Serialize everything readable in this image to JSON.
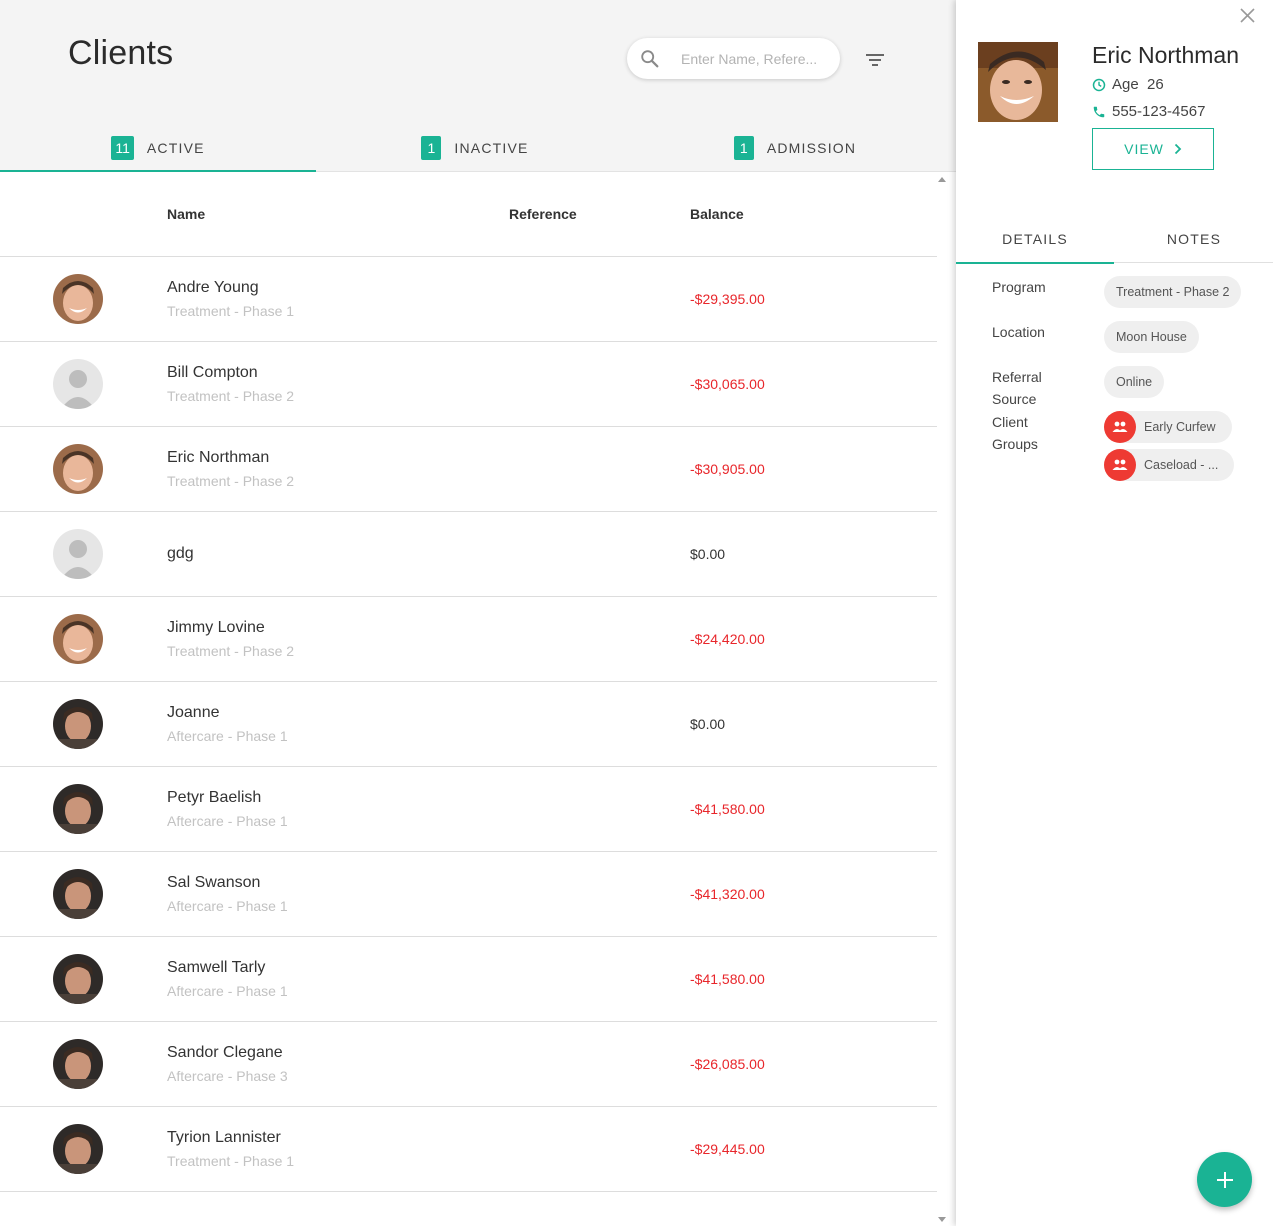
{
  "header": {
    "title": "Clients",
    "search_placeholder": "Enter Name, Refere..."
  },
  "tabs": [
    {
      "count": "11",
      "label": "ACTIVE"
    },
    {
      "count": "1",
      "label": "INACTIVE"
    },
    {
      "count": "1",
      "label": "ADMISSION"
    }
  ],
  "table": {
    "columns": [
      "Name",
      "Reference",
      "Balance"
    ],
    "rows": [
      {
        "name": "Andre Young",
        "program": "Treatment - Phase 1",
        "balance": "-$29,395.00",
        "avatar": "photo-light"
      },
      {
        "name": "Bill Compton",
        "program": "Treatment - Phase 2",
        "balance": "-$30,065.00",
        "avatar": "placeholder"
      },
      {
        "name": "Eric Northman",
        "program": "Treatment - Phase 2",
        "balance": "-$30,905.00",
        "avatar": "photo-light"
      },
      {
        "name": "gdg",
        "program": "",
        "balance": "$0.00",
        "avatar": "placeholder"
      },
      {
        "name": "Jimmy Lovine",
        "program": "Treatment - Phase 2",
        "balance": "-$24,420.00",
        "avatar": "photo-light"
      },
      {
        "name": "Joanne",
        "program": "Aftercare - Phase 1",
        "balance": "$0.00",
        "avatar": "photo-dark"
      },
      {
        "name": "Petyr Baelish",
        "program": "Aftercare - Phase 1",
        "balance": "-$41,580.00",
        "avatar": "photo-dark"
      },
      {
        "name": "Sal Swanson",
        "program": "Aftercare - Phase 1",
        "balance": "-$41,320.00",
        "avatar": "photo-dark"
      },
      {
        "name": "Samwell Tarly",
        "program": "Aftercare - Phase 1",
        "balance": "-$41,580.00",
        "avatar": "photo-dark"
      },
      {
        "name": "Sandor Clegane",
        "program": "Aftercare - Phase 3",
        "balance": "-$26,085.00",
        "avatar": "photo-dark"
      },
      {
        "name": "Tyrion Lannister",
        "program": "Treatment - Phase 1",
        "balance": "-$29,445.00",
        "avatar": "photo-dark"
      }
    ]
  },
  "detail": {
    "name": "Eric Northman",
    "age_label": "Age",
    "age": "26",
    "phone": "555-123-4567",
    "view_label": "VIEW",
    "tabs": [
      "DETAILS",
      "NOTES"
    ],
    "labels": {
      "program": "Program",
      "location": "Location",
      "referral_1": "Referral",
      "referral_2": "Source",
      "groups_1": "Client",
      "groups_2": "Groups"
    },
    "values": {
      "program": "Treatment - Phase 2",
      "location": "Moon House",
      "referral": "Online",
      "group_1": "Early Curfew",
      "group_2": "Caseload - ..."
    }
  },
  "colors": {
    "accent": "#1ab394",
    "negative": "#e8262b",
    "chip_icon": "#ee3a33"
  },
  "icons": [
    "search-icon",
    "filter-icon",
    "close-icon",
    "clock-icon",
    "phone-icon",
    "chevron-right-icon",
    "group-icon",
    "plus-icon"
  ]
}
